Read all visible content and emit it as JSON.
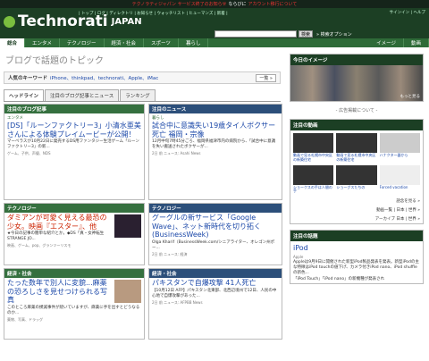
{
  "topbar": {
    "part1": "テクノラティジャパン サービス終了のお知らせ",
    "part2": "ならびに",
    "part3": "アカウント移行について"
  },
  "header": {
    "logo": "Technorati",
    "jp": "JAPAN",
    "toplinks": "| トップ | ログ | ディレクトリ | お知らせ | ウォッチリスト | ヒューマンズ | 新着 |",
    "right": "サインイン | ヘルプ",
    "search_btn": "検索",
    "adv": "» 検索オプション"
  },
  "nav": [
    "総合",
    "エンタメ",
    "テクノロジー",
    "経済・社会",
    "スポーツ",
    "暮らし",
    "イメージ",
    "動画"
  ],
  "page": {
    "title": "ブログで話題のトピック",
    "kw_label": "人気のキーワード",
    "kw_items": "iPhone、thinkpad、technorati、Apple、iMac",
    "kw_list": "一覧 »"
  },
  "tabs": [
    "ヘッドライン",
    "注目のブログ記事とニュース",
    "ランキング"
  ],
  "cards": [
    {
      "h": "注目のブログ記事",
      "tag": "エンタメ",
      "title": "[DS]「ルーンファクトリー3」小清水亜美さんによる体験プレイムービーが公開！",
      "txt": "マーベラスが10月22日に発売するDS用ファンタジー生活ゲーム「ルーンファクトリー3」の新...",
      "meta": "ゲーム、子供、声優、NDS"
    },
    {
      "h": "注目のニュース",
      "tag": "暮らし",
      "title": "試合中に意識失い19歳タイ人ボクサー死亡 福岡・宗像",
      "txt": "12月中旬7時45分ごろ、福岡県福津市内の病院から、「試合中に意識を失い搬送されたボクサーが...",
      "meta": "2日 前 ニュース: Asahi News",
      "red": false
    },
    {
      "h": "テクノロジー",
      "tag": "",
      "title": "ダミアンが可愛く見える最恐の少女。映画『エスター』、他",
      "txt": "★今日の記事の簡単な紹介とか。◆DS「真・女神転生 STRANGE JO...",
      "meta": "映画、ゲーム、pop、グランツーリスモ"
    },
    {
      "h": "テクノロジー",
      "tag": "",
      "title": "グーグルの新サービス「Google Wave」、ネット新時代を切り拓く(BusinessWeek)",
      "txt": "Olga Kharif（BusinessWeek.com/シニアライター、オレゴン州ポー...",
      "meta": "2日 前 ニュース: 経済"
    },
    {
      "h": "経済・社会",
      "tag": "",
      "title": "たった数年で別人に変貌...麻薬の恐ろしさを見せつけられる写真",
      "txt": "このところ麻薬の撲滅事件が続いていますが、麻薬に手を出すとどうなるのか...",
      "meta": "薬物、写真、ドラッグ"
    },
    {
      "h": "経済・社会",
      "tag": "",
      "title": "パキスタンで自爆攻撃 41人死亡",
      "txt": "【10月12日 AFP】パキスタン北東部、北西辺境州で12日、人民の中心地で自爆攻撃があった...",
      "meta": "2日 前 ニュース: AFPBB News"
    }
  ],
  "side": {
    "today": "今日のイメージ",
    "more": "もっと見る",
    "ad": "- 広告掲載について -",
    "video": "注目の動画",
    "vids": [
      "動画で見る札幌市中央区の新築住宅",
      "動画で見る札幌市中央区の新築住宅",
      "ハナクター器から",
      "ショークスの手は人間の手",
      "ショーグスたちの",
      "Forced vacation"
    ],
    "vidmore": "語念を見る »",
    "related": "動画一覧 | 日本 | 世界 »",
    "archive": "アーカイブ 日本 | 世界 »",
    "topic": "注目の話題",
    "ipod": "iPod",
    "ipodtag": "Apple",
    "ipodtxt": "Appleは9月9日に開催された新型iPod製品発表を発表。新型iPodの主な特徴はiPod touchの値下げ、カメラ付きiPod nano、iPod shuffleの新色...",
    "ipod2": "「iPod Touch」「iPod nano」の新機種が発表され"
  }
}
